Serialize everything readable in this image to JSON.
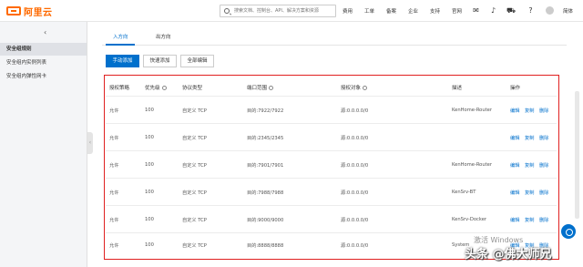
{
  "header": {
    "logo_text": "阿里云",
    "search_placeholder": "搜索文档、控制台、API、解决方案和资源",
    "nav": [
      "费用",
      "工单",
      "备案",
      "企业",
      "支持",
      "官网"
    ],
    "lang": "简体"
  },
  "sidebar": {
    "items": [
      "安全组规则",
      "安全组内实例列表",
      "安全组内弹性网卡"
    ]
  },
  "tabs": [
    "入方向",
    "出方向"
  ],
  "buttons": {
    "manual_add": "手动添加",
    "quick_add": "快速添加",
    "all_edit": "全部编辑"
  },
  "table": {
    "headers": [
      "授权策略",
      "优先级",
      "协议类型",
      "端口范围",
      "授权对象",
      "描述",
      "操作"
    ],
    "rows": [
      {
        "policy": "允许",
        "priority": "100",
        "protocol": "自定义 TCP",
        "port": "目的:7922/7922",
        "source": "源:0.0.0.0/0",
        "desc": "KenHome-Router"
      },
      {
        "policy": "允许",
        "priority": "100",
        "protocol": "自定义 TCP",
        "port": "目的:2345/2345",
        "source": "源:0.0.0.0/0",
        "desc": ""
      },
      {
        "policy": "允许",
        "priority": "100",
        "protocol": "自定义 TCP",
        "port": "目的:7901/7901",
        "source": "源:0.0.0.0/0",
        "desc": "KenHome-Router"
      },
      {
        "policy": "允许",
        "priority": "100",
        "protocol": "自定义 TCP",
        "port": "目的:7988/7988",
        "source": "源:0.0.0.0/0",
        "desc": "KenSrv-BT"
      },
      {
        "policy": "允许",
        "priority": "100",
        "protocol": "自定义 TCP",
        "port": "目的:9000/9000",
        "source": "源:0.0.0.0/0",
        "desc": "KenSrv-Docker"
      },
      {
        "policy": "允许",
        "priority": "100",
        "protocol": "自定义 TCP",
        "port": "目的:8888/8888",
        "source": "源:0.0.0.0/0",
        "desc": "System"
      }
    ],
    "ops": [
      "编辑",
      "复制",
      "删除"
    ]
  },
  "overlay": {
    "activate_windows": "激活 Windows",
    "watermark": "头条 @佛大师兄"
  },
  "colors": {
    "brand": "#ff6a00",
    "primary": "#0070cc",
    "highlight_border": "#e02020"
  }
}
